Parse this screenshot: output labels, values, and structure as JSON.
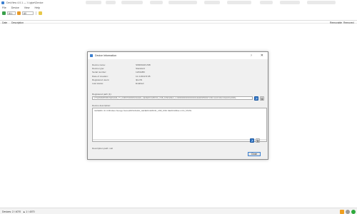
{
  "window": {
    "title": "DevView 4.0.1 — \\\\.\\pipe\\Device"
  },
  "menu": [
    "File",
    "Device",
    "View",
    "Help"
  ],
  "toolbar": {
    "combo_device": "ALL",
    "combo_filter": "All"
  },
  "columns": {
    "left": [
      "Date",
      "Description"
    ],
    "right": [
      "Removable",
      "Removed"
    ]
  },
  "dialog": {
    "title": "Device Information",
    "help_glyph": "?",
    "close_glyph": "✕",
    "properties": [
      {
        "label": "Device name:",
        "value": "SWD\\DAFUSB"
      },
      {
        "label": "Device type:",
        "value": "Standard"
      },
      {
        "label": "Serial number:",
        "value": "1234ABC"
      },
      {
        "label": "Date of creation:",
        "value": "11.4.2022 8:05"
      },
      {
        "label": "Registered users:",
        "value": "Ilpo\\IN"
      },
      {
        "label": "Last status:",
        "value": "Enabled"
      }
    ],
    "path_label": "Registered path (1):",
    "path_value": "\\\\?\\SWD#WPDBUSENUM#_??_USBSTOR#DISK&VEN_GENERIC&PROD_USB_DISK&REV_1.00#0000000000000001&0#{53f56307-b6bf-11d0-94f2-00a0c91efb8b}",
    "description_label": "Device description:",
    "description_value": "GENERIC     3C     USB Mass Storage Device#DISK&VEN_GENERIC&PROD_USB_DISK     REMOVABLE     4     ON_STATE",
    "footer_label": "Description path: null",
    "ok_label": "Close"
  },
  "status": {
    "left": "Devices: 2 / 4070",
    "mid": "▲ 1 / 4070"
  },
  "colors": {
    "accent": "#3b7fd0",
    "toolbar_green": "#3aa04a",
    "toolbar_orange": "#e89a28",
    "toolbar_yellow": "#e7c84a",
    "status_green": "#2eaa3c",
    "status_orange": "#f0a020"
  }
}
